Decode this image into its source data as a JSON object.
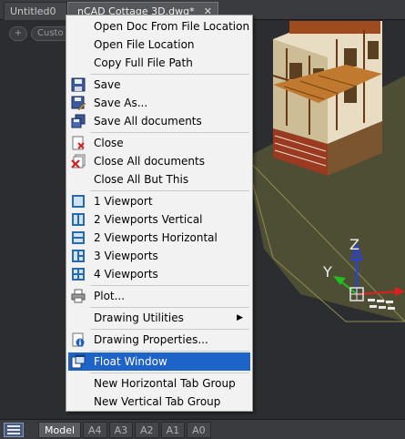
{
  "tabs": {
    "inactive_label": "Untitled0",
    "active_label": "nCAD Cottage 3D.dwg*",
    "close_glyph": "✕"
  },
  "viewport": {
    "plus_label": "+",
    "custom_label": "Custo"
  },
  "axes": {
    "z": "Z",
    "y": "Y"
  },
  "context_menu": {
    "items": [
      {
        "label": "Open Doc From File Location",
        "icon": ""
      },
      {
        "label": "Open File Location",
        "icon": ""
      },
      {
        "label": "Copy Full File Path",
        "icon": ""
      },
      {
        "label": "Save",
        "icon": "save-icon"
      },
      {
        "label": "Save As...",
        "icon": "save-as-icon"
      },
      {
        "label": "Save All documents",
        "icon": "save-all-icon"
      },
      {
        "label": "Close",
        "icon": "close-doc-icon"
      },
      {
        "label": "Close All documents",
        "icon": "close-all-icon"
      },
      {
        "label": "Close All But This",
        "icon": ""
      },
      {
        "label": "1 Viewport",
        "icon": "one-viewport-icon"
      },
      {
        "label": "2 Viewports Vertical",
        "icon": "two-viewports-vertical-icon"
      },
      {
        "label": "2 Viewports Horizontal",
        "icon": "two-viewports-horizontal-icon"
      },
      {
        "label": "3 Viewports",
        "icon": "three-viewports-icon"
      },
      {
        "label": "4 Viewports",
        "icon": "four-viewports-icon"
      },
      {
        "label": "Plot...",
        "icon": "printer-icon"
      },
      {
        "label": "Drawing Utilities",
        "icon": "",
        "submenu_arrow": "▶"
      },
      {
        "label": "Drawing Properties...",
        "icon": "properties-icon"
      },
      {
        "label": "Float Window",
        "icon": "float-window-icon",
        "highlighted": true
      },
      {
        "label": "New Horizontal Tab Group",
        "icon": ""
      },
      {
        "label": "New Vertical Tab Group",
        "icon": ""
      }
    ]
  },
  "layout_tabs": [
    "Model",
    "A4",
    "A3",
    "A2",
    "A1",
    "A0"
  ],
  "colors": {
    "menu_highlight": "#1e63c8",
    "axis_x": "#e02020",
    "axis_y": "#20c020",
    "axis_z": "#2040ff"
  }
}
